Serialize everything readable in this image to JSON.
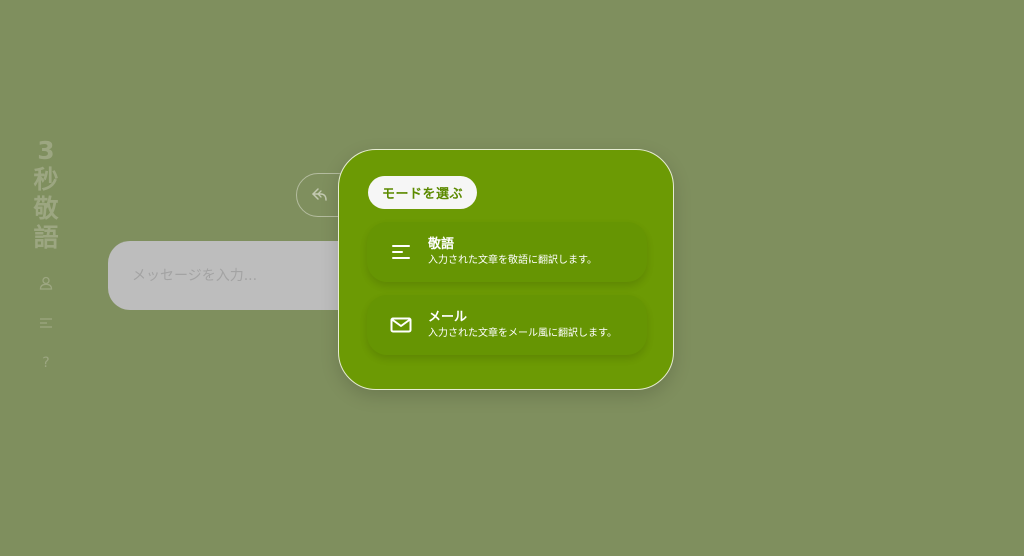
{
  "app": {
    "title_chars": [
      "3",
      "秒",
      "敬",
      "語"
    ]
  },
  "sidebar": {
    "icons": [
      {
        "name": "user-icon",
        "glyph": "user"
      },
      {
        "name": "menu-icon",
        "glyph": "lines"
      },
      {
        "name": "help-icon",
        "glyph": "?"
      }
    ],
    "help_glyph": "?"
  },
  "composer": {
    "placeholder": "メッセージを入力..."
  },
  "popup": {
    "title": "モードを選ぶ",
    "options": [
      {
        "name": "敬語",
        "description": "入力された文章を敬語に翻訳します。",
        "icon": "text-lines-icon"
      },
      {
        "name": "メール",
        "description": "入力された文章をメール風に翻訳します。",
        "icon": "mail-icon"
      }
    ]
  },
  "colors": {
    "background": "#7f8f5e",
    "popup": "#6c9a04",
    "option": "#669503",
    "accent_text": "#5c8a00"
  }
}
